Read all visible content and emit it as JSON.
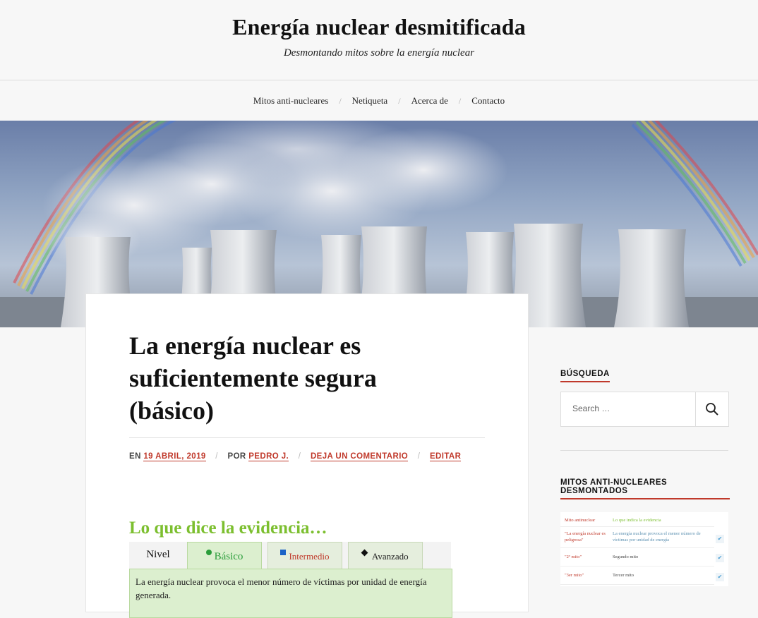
{
  "site": {
    "title": "Energía nuclear desmitificada",
    "description": "Desmontando mitos sobre la energía nuclear"
  },
  "nav": {
    "items": [
      {
        "label": "Mitos anti-nucleares"
      },
      {
        "label": "Netiqueta"
      },
      {
        "label": "Acerca de"
      },
      {
        "label": "Contacto"
      }
    ],
    "separator": "/"
  },
  "post": {
    "title": "La energía nuclear es suficientemente segura (básico)",
    "meta": {
      "on_prefix": "EN",
      "date": "19 ABRIL, 2019",
      "by_prefix": "POR",
      "author": "PEDRO J.",
      "comment": "DEJA UN COMENTARIO",
      "edit": "EDITAR"
    },
    "evidence": {
      "heading": "Lo que dice la evidencia…",
      "level_label": "Nivel",
      "tabs": [
        {
          "label": "Básico",
          "marker": "green-circle"
        },
        {
          "label": "Intermedio",
          "marker": "blue-square"
        },
        {
          "label": "Avanzado",
          "marker": "black-diamond"
        }
      ],
      "text": "La energía nuclear provoca el menor número de víctimas por unidad de energía generada."
    }
  },
  "sidebar": {
    "search_title": "BÚSQUEDA",
    "search_placeholder": "Search …",
    "myths_title": "MITOS ANTI-NUCLEARES DESMONTADOS",
    "myths_table": {
      "headers": [
        "Mito antinuclear",
        "Lo que indica la evidencia"
      ],
      "rows": [
        {
          "myth": "\"La energía nuclear es peligrosa\"",
          "evidence": "La energía nuclear provoca el menor número de víctimas por unidad de energía"
        },
        {
          "myth": "\"2º mito\"",
          "evidence": "Segundo mito"
        },
        {
          "myth": "\"3er mito\"",
          "evidence": "Tercer mito"
        }
      ]
    }
  },
  "colors": {
    "accent_red": "#c0392b",
    "evidence_green": "#7cbf2f",
    "tab_green": "#dcefcf"
  }
}
